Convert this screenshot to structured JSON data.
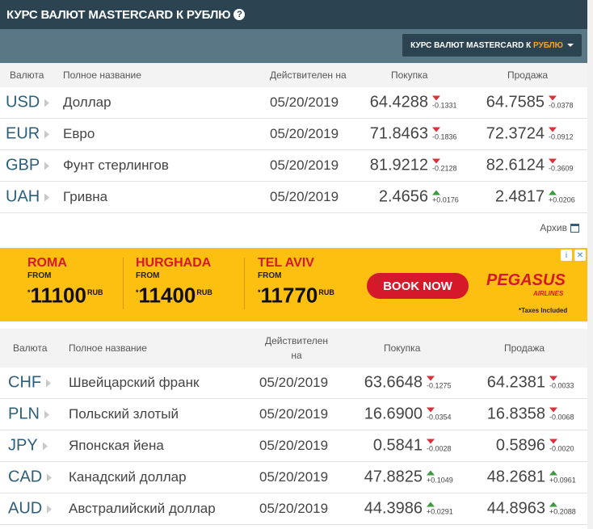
{
  "title": "КУРС ВАЛЮТ MASTERCARD К РУБЛЮ",
  "help_icon": "?",
  "dropdown": {
    "label_prefix": "КУРС ВАЛЮТ MASTERCARD К",
    "label_highlight": "РУБЛЮ"
  },
  "table1": {
    "headers": {
      "currency": "Валюта",
      "full_name": "Полное название",
      "valid_on": "Действителен на",
      "buy": "Покупка",
      "sell": "Продажа"
    },
    "rows": [
      {
        "code": "USD",
        "name": "Доллар",
        "date": "05/20/2019",
        "buy": "64.4288",
        "buy_change": "-0.1331",
        "buy_dir": "down",
        "sell": "64.7585",
        "sell_change": "-0.0378",
        "sell_dir": "down"
      },
      {
        "code": "EUR",
        "name": "Евро",
        "date": "05/20/2019",
        "buy": "71.8463",
        "buy_change": "-0.1836",
        "buy_dir": "down",
        "sell": "72.3724",
        "sell_change": "-0.0912",
        "sell_dir": "down"
      },
      {
        "code": "GBP",
        "name": "Фунт стерлингов",
        "date": "05/20/2019",
        "buy": "81.9212",
        "buy_change": "-0.2128",
        "buy_dir": "down",
        "sell": "82.6124",
        "sell_change": "-0.3609",
        "sell_dir": "down"
      },
      {
        "code": "UAH",
        "name": "Гривна",
        "date": "05/20/2019",
        "buy": "2.4656",
        "buy_change": "+0.0176",
        "buy_dir": "up",
        "sell": "2.4817",
        "sell_change": "+0.0206",
        "sell_dir": "up"
      }
    ]
  },
  "archive": "Архив",
  "ad": {
    "deals": [
      {
        "city": "ROMA",
        "from": "FROM",
        "price": "11100",
        "currency": "RUB"
      },
      {
        "city": "HURGHADA",
        "from": "FROM",
        "price": "11400",
        "currency": "RUB"
      },
      {
        "city": "TEL AVIV",
        "from": "FROM",
        "price": "11770",
        "currency": "RUB"
      }
    ],
    "button": "BOOK NOW",
    "brand": "PEGASUS",
    "brand_sub": "AIRLINES",
    "taxes": "*Taxes Included"
  },
  "table2": {
    "headers": {
      "currency": "Валюта",
      "full_name": "Полное название",
      "valid_on_1": "Действителен",
      "valid_on_2": "на",
      "buy": "Покупка",
      "sell": "Продажа"
    },
    "rows": [
      {
        "code": "CHF",
        "name": "Швейцарский франк",
        "date": "05/20/2019",
        "buy": "63.6648",
        "buy_change": "-0.1275",
        "buy_dir": "down",
        "sell": "64.2381",
        "sell_change": "-0.0033",
        "sell_dir": "down"
      },
      {
        "code": "PLN",
        "name": "Польский злотый",
        "date": "05/20/2019",
        "buy": "16.6900",
        "buy_change": "-0.0354",
        "buy_dir": "down",
        "sell": "16.8358",
        "sell_change": "-0.0068",
        "sell_dir": "down"
      },
      {
        "code": "JPY",
        "name": "Японская йена",
        "date": "05/20/2019",
        "buy": "0.5841",
        "buy_change": "-0.0028",
        "buy_dir": "down",
        "sell": "0.5896",
        "sell_change": "-0.0020",
        "sell_dir": "down"
      },
      {
        "code": "CAD",
        "name": "Канадский доллар",
        "date": "05/20/2019",
        "buy": "47.8825",
        "buy_change": "+0.1049",
        "buy_dir": "up",
        "sell": "48.2681",
        "sell_change": "+0.0961",
        "sell_dir": "up"
      },
      {
        "code": "AUD",
        "name": "Австралийский доллар",
        "date": "05/20/2019",
        "buy": "44.3986",
        "buy_change": "+0.0291",
        "buy_dir": "up",
        "sell": "44.8963",
        "sell_change": "+0.2088",
        "sell_dir": "up"
      }
    ]
  },
  "colors": {
    "header": "#2c4452",
    "subbar": "#597784",
    "down": "#d8313a",
    "up": "#3a9b3f",
    "ad_bg": "#fec010",
    "brand_red": "#d5192b"
  }
}
